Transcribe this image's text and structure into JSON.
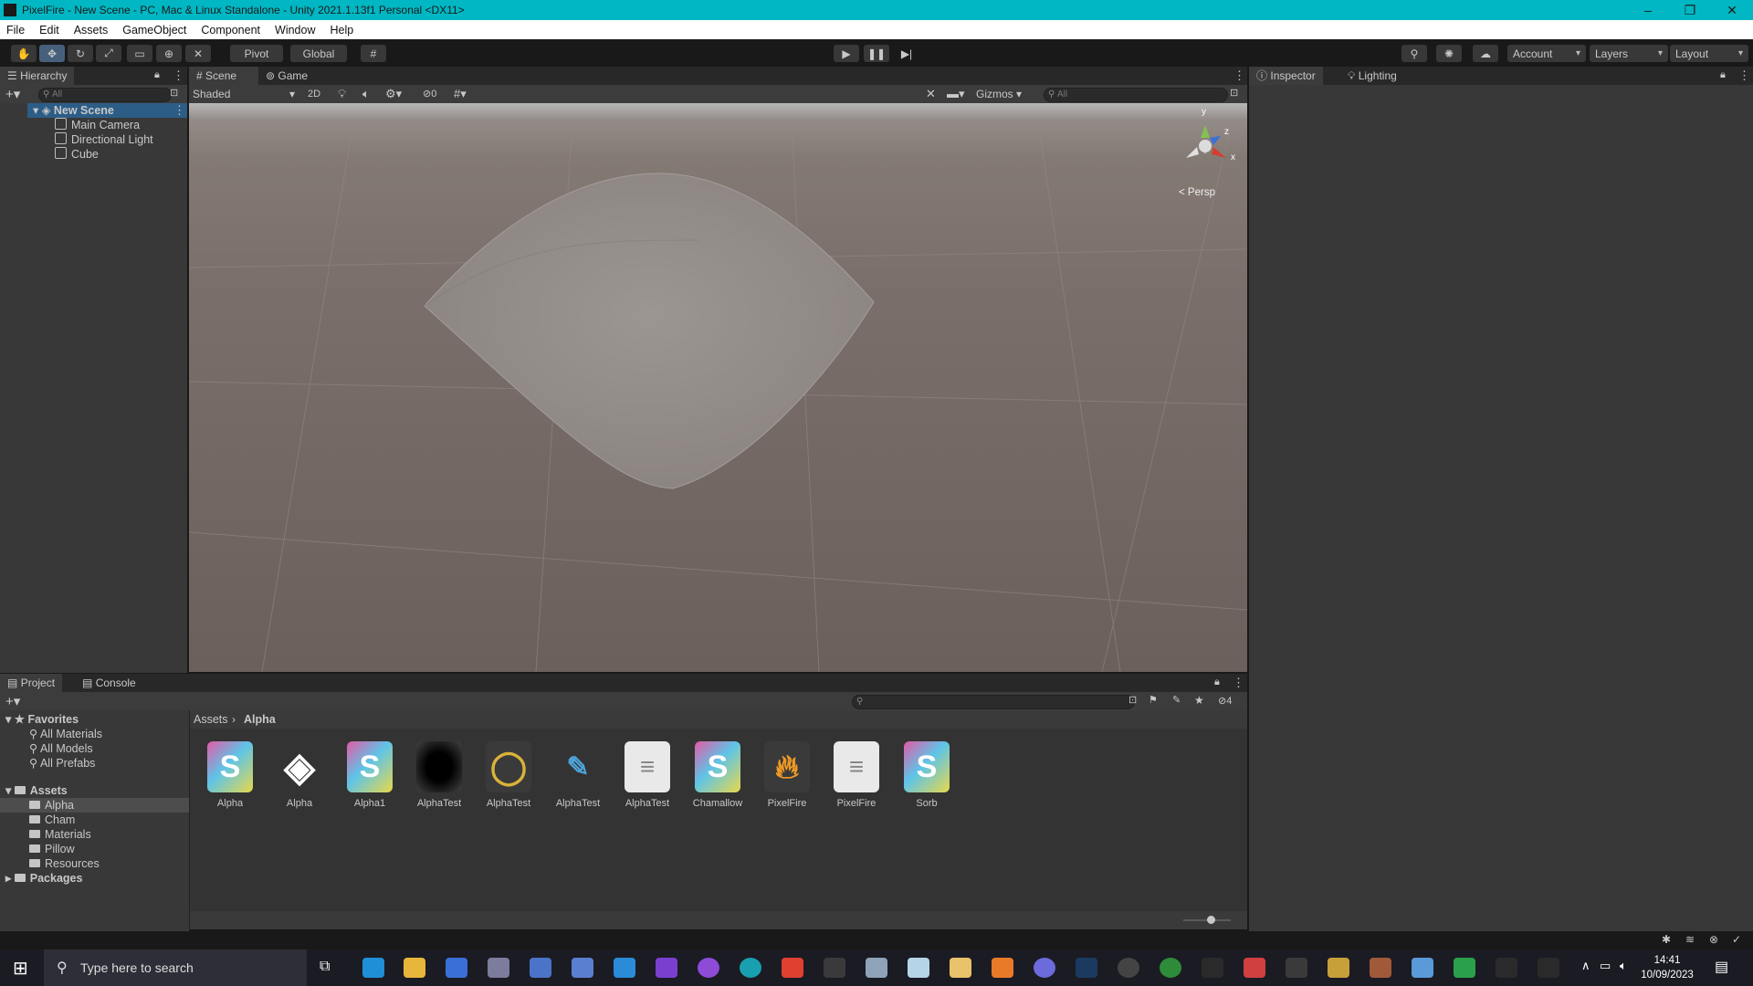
{
  "window": {
    "title": "PixelFire - New Scene - PC, Mac & Linux Standalone - Unity 2021.1.13f1 Personal <DX11>",
    "controls": [
      "–",
      "❐",
      "✕"
    ]
  },
  "menu": [
    "File",
    "Edit",
    "Assets",
    "GameObject",
    "Component",
    "Window",
    "Help"
  ],
  "toolbar": {
    "pivot": "Pivot",
    "global": "Global",
    "account": "Account",
    "layers": "Layers",
    "layout": "Layout"
  },
  "hierarchy": {
    "tab": "Hierarchy",
    "search_placeholder": "All",
    "scene_name": "New Scene",
    "items": [
      "Main Camera",
      "Directional Light",
      "Cube"
    ]
  },
  "scene_view": {
    "tabs": [
      "Scene",
      "Game"
    ],
    "shading_mode": "Shaded",
    "mode_2d": "2D",
    "hidden_count": "0",
    "gizmos": "Gizmos",
    "search_placeholder": "All",
    "projection": "Persp",
    "axes": {
      "y": "y",
      "z": "z",
      "x": "x"
    }
  },
  "inspector": {
    "tabs": [
      "Inspector",
      "Lighting"
    ]
  },
  "project": {
    "tabs": [
      "Project",
      "Console"
    ],
    "hidden_count": "4",
    "breadcrumb": [
      "Assets",
      "Alpha"
    ],
    "favorites": {
      "label": "Favorites",
      "items": [
        "All Materials",
        "All Models",
        "All Prefabs"
      ]
    },
    "assets_root": "Assets",
    "folders": [
      "Alpha",
      "Cham",
      "Materials",
      "Pillow",
      "Resources"
    ],
    "packages": "Packages",
    "assets": [
      {
        "name": "Alpha",
        "icon": "shader-icon"
      },
      {
        "name": "Alpha",
        "icon": "unity-scene-icon"
      },
      {
        "name": "Alpha1",
        "icon": "shader-icon"
      },
      {
        "name": "AlphaTest",
        "icon": "texture-black-icon"
      },
      {
        "name": "AlphaTest",
        "icon": "material-ring-icon"
      },
      {
        "name": "AlphaTest",
        "icon": "script-icon"
      },
      {
        "name": "AlphaTest",
        "icon": "text-document-icon"
      },
      {
        "name": "Chamallow",
        "icon": "shader-icon"
      },
      {
        "name": "PixelFire",
        "icon": "fire-icon"
      },
      {
        "name": "PixelFire",
        "icon": "text-document-icon"
      },
      {
        "name": "Sorb",
        "icon": "shader-icon"
      }
    ]
  },
  "taskbar": {
    "search_placeholder": "Type here to search",
    "time": "14:41",
    "date": "10/09/2023"
  },
  "colors": {
    "titlebar": "#00b7c3",
    "selection": "#46607c",
    "panel": "#383838"
  }
}
